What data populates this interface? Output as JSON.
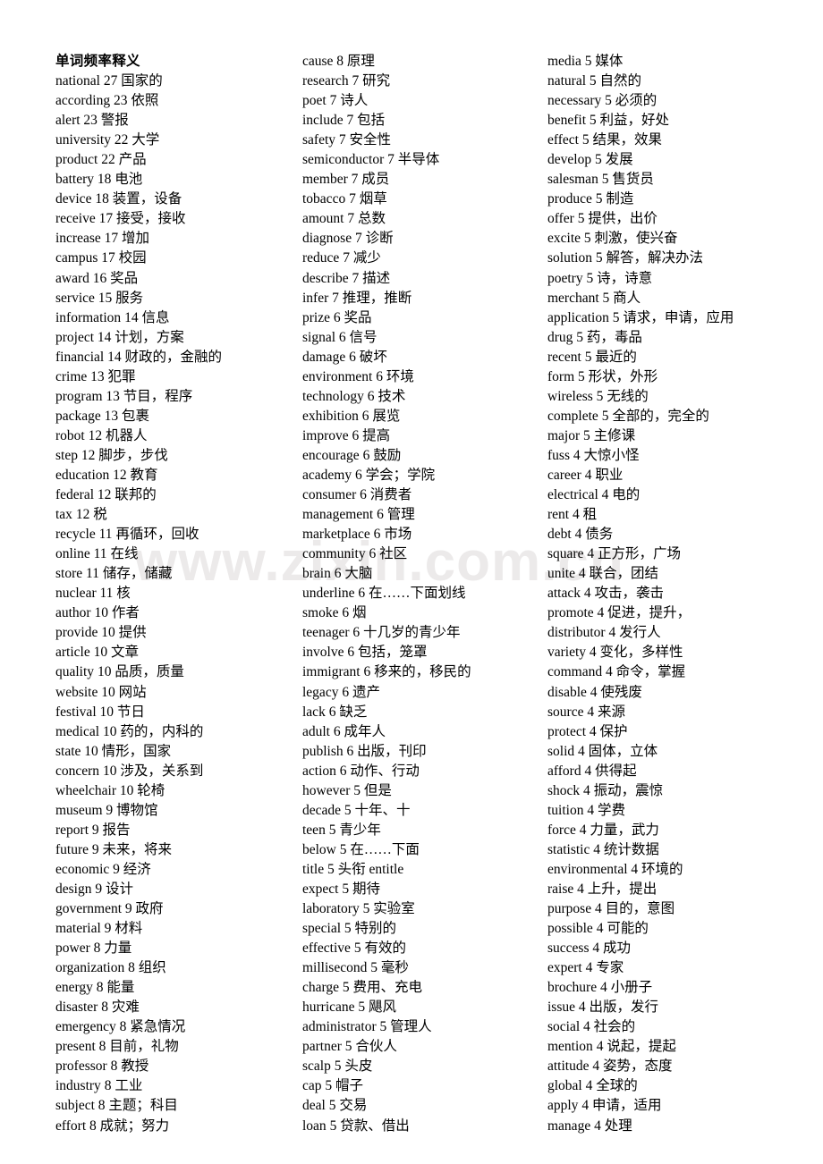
{
  "document": {
    "heading": "单词频率释义",
    "watermark": "www.zixin.com.cn"
  },
  "columns": [
    {
      "id": "col-1",
      "heading": "单词频率释义",
      "entries": [
        {
          "word": "national",
          "count": "27",
          "meaning": "国家的"
        },
        {
          "word": "according",
          "count": "23",
          "meaning": "依照"
        },
        {
          "word": "alert",
          "count": "23",
          "meaning": "警报"
        },
        {
          "word": "university",
          "count": "22",
          "meaning": "大学"
        },
        {
          "word": "product",
          "count": "22",
          "meaning": "产品"
        },
        {
          "word": "battery",
          "count": "18",
          "meaning": "电池"
        },
        {
          "word": "device",
          "count": "18",
          "meaning": "装置，设备"
        },
        {
          "word": "receive",
          "count": "17",
          "meaning": "接受，接收"
        },
        {
          "word": "increase",
          "count": "17",
          "meaning": "增加"
        },
        {
          "word": "campus",
          "count": "17",
          "meaning": "校园"
        },
        {
          "word": "award",
          "count": "16",
          "meaning": "奖品"
        },
        {
          "word": "service",
          "count": "15",
          "meaning": "服务"
        },
        {
          "word": "information",
          "count": "14",
          "meaning": "信息"
        },
        {
          "word": "project",
          "count": "14",
          "meaning": "计划，方案"
        },
        {
          "word": "financial",
          "count": "14",
          "meaning": "财政的，金融的"
        },
        {
          "word": "crime",
          "count": "13",
          "meaning": "犯罪"
        },
        {
          "word": "program",
          "count": "13",
          "meaning": "节目，程序"
        },
        {
          "word": "package",
          "count": "13",
          "meaning": "包裹"
        },
        {
          "word": "robot",
          "count": "12",
          "meaning": "机器人"
        },
        {
          "word": "step",
          "count": "12",
          "meaning": "脚步，步伐"
        },
        {
          "word": "education",
          "count": "12",
          "meaning": "教育"
        },
        {
          "word": "federal",
          "count": "12",
          "meaning": "联邦的"
        },
        {
          "word": "tax",
          "count": "12",
          "meaning": "税"
        },
        {
          "word": "recycle",
          "count": "11",
          "meaning": "再循环，回收"
        },
        {
          "word": "online",
          "count": "11",
          "meaning": "在线"
        },
        {
          "word": "store",
          "count": "11",
          "meaning": "储存，储藏"
        },
        {
          "word": "nuclear",
          "count": "11",
          "meaning": "核"
        },
        {
          "word": "author",
          "count": "10",
          "meaning": "作者"
        },
        {
          "word": "provide",
          "count": "10",
          "meaning": "提供"
        },
        {
          "word": "article",
          "count": "10",
          "meaning": "文章"
        },
        {
          "word": "quality",
          "count": "10",
          "meaning": "品质，质量"
        },
        {
          "word": "website",
          "count": "10",
          "meaning": "网站"
        },
        {
          "word": "festival",
          "count": "10",
          "meaning": "节日"
        },
        {
          "word": "medical",
          "count": "10",
          "meaning": "药的，内科的"
        },
        {
          "word": "state",
          "count": "10",
          "meaning": "情形，国家"
        },
        {
          "word": "concern",
          "count": "10",
          "meaning": "涉及，关系到"
        },
        {
          "word": "wheelchair",
          "count": "10",
          "meaning": "轮椅"
        },
        {
          "word": "museum",
          "count": "9",
          "meaning": "博物馆"
        },
        {
          "word": "report",
          "count": "9",
          "meaning": "报告"
        },
        {
          "word": "future",
          "count": "9",
          "meaning": "未来，将来"
        },
        {
          "word": "economic",
          "count": "9",
          "meaning": "经济"
        },
        {
          "word": "design",
          "count": "9",
          "meaning": "设计"
        },
        {
          "word": "government",
          "count": "9",
          "meaning": "政府"
        },
        {
          "word": "material",
          "count": "9",
          "meaning": "材料"
        },
        {
          "word": "power",
          "count": "8",
          "meaning": "力量"
        },
        {
          "word": "organization",
          "count": "8",
          "meaning": "组织"
        },
        {
          "word": "energy",
          "count": "8",
          "meaning": "能量"
        },
        {
          "word": "disaster",
          "count": "8",
          "meaning": "灾难"
        },
        {
          "word": "emergency",
          "count": "8",
          "meaning": "紧急情况"
        },
        {
          "word": "present",
          "count": "8",
          "meaning": "目前，礼物"
        },
        {
          "word": "professor",
          "count": "8",
          "meaning": "教授"
        },
        {
          "word": "industry",
          "count": "8",
          "meaning": "工业"
        },
        {
          "word": "subject",
          "count": "8",
          "meaning": "主题；科目"
        },
        {
          "word": "effort",
          "count": "8",
          "meaning": "成就；努力"
        }
      ]
    },
    {
      "id": "col-2",
      "heading": "",
      "entries": [
        {
          "word": "cause",
          "count": "8",
          "meaning": "原理"
        },
        {
          "word": "research",
          "count": "7",
          "meaning": "研究"
        },
        {
          "word": "poet",
          "count": "7",
          "meaning": "诗人"
        },
        {
          "word": "include",
          "count": "7",
          "meaning": "包括"
        },
        {
          "word": "safety",
          "count": "7",
          "meaning": "安全性"
        },
        {
          "word": "semiconductor",
          "count": "7",
          "meaning": "半导体"
        },
        {
          "word": "member",
          "count": "7",
          "meaning": "成员"
        },
        {
          "word": "tobacco",
          "count": "7",
          "meaning": "烟草"
        },
        {
          "word": "amount",
          "count": "7",
          "meaning": "总数"
        },
        {
          "word": "diagnose",
          "count": "7",
          "meaning": "诊断"
        },
        {
          "word": "reduce",
          "count": "7",
          "meaning": "减少"
        },
        {
          "word": "describe",
          "count": "7",
          "meaning": "描述"
        },
        {
          "word": "infer",
          "count": "7",
          "meaning": "推理，推断"
        },
        {
          "word": "prize",
          "count": "6",
          "meaning": "奖品"
        },
        {
          "word": "signal",
          "count": "6",
          "meaning": "信号"
        },
        {
          "word": "damage",
          "count": "6",
          "meaning": "破坏"
        },
        {
          "word": "environment",
          "count": "6",
          "meaning": "环境"
        },
        {
          "word": "technology",
          "count": "6",
          "meaning": "技术"
        },
        {
          "word": "exhibition",
          "count": "6",
          "meaning": "展览"
        },
        {
          "word": "improve",
          "count": "6",
          "meaning": "提高"
        },
        {
          "word": "encourage",
          "count": "6",
          "meaning": "鼓励"
        },
        {
          "word": "academy",
          "count": "6",
          "meaning": "学会；学院"
        },
        {
          "word": "consumer",
          "count": "6",
          "meaning": "消费者"
        },
        {
          "word": "management",
          "count": "6",
          "meaning": "管理"
        },
        {
          "word": "marketplace",
          "count": "6",
          "meaning": "市场"
        },
        {
          "word": "community",
          "count": "6",
          "meaning": "社区"
        },
        {
          "word": "brain",
          "count": "6",
          "meaning": "大脑"
        },
        {
          "word": "underline",
          "count": "6",
          "meaning": "在……下面划线"
        },
        {
          "word": "smoke",
          "count": "6",
          "meaning": "烟"
        },
        {
          "word": "teenager",
          "count": "6",
          "meaning": "十几岁的青少年"
        },
        {
          "word": "involve",
          "count": "6",
          "meaning": "包括，笼罩"
        },
        {
          "word": "immigrant",
          "count": "6",
          "meaning": "移来的，移民的"
        },
        {
          "word": "legacy",
          "count": "6",
          "meaning": "遗产"
        },
        {
          "word": "lack",
          "count": "6",
          "meaning": "缺乏"
        },
        {
          "word": "adult",
          "count": "6",
          "meaning": "成年人"
        },
        {
          "word": "publish",
          "count": "6",
          "meaning": "出版，刊印"
        },
        {
          "word": "action",
          "count": "6",
          "meaning": "动作、行动"
        },
        {
          "word": "however",
          "count": "5",
          "meaning": "但是"
        },
        {
          "word": "decade",
          "count": "5",
          "meaning": "十年、十"
        },
        {
          "word": "teen",
          "count": "5",
          "meaning": "青少年"
        },
        {
          "word": "below",
          "count": "5",
          "meaning": "在……下面"
        },
        {
          "word": "title",
          "count": "5",
          "meaning": "头衔 entitle"
        },
        {
          "word": "expect",
          "count": "5",
          "meaning": "期待"
        },
        {
          "word": "laboratory",
          "count": "5",
          "meaning": "实验室"
        },
        {
          "word": "special",
          "count": "5",
          "meaning": "特别的"
        },
        {
          "word": "effective",
          "count": "5",
          "meaning": "有效的"
        },
        {
          "word": "millisecond",
          "count": "5",
          "meaning": "毫秒"
        },
        {
          "word": "charge",
          "count": "5",
          "meaning": "费用、充电"
        },
        {
          "word": "hurricane",
          "count": "5",
          "meaning": "飓风"
        },
        {
          "word": "administrator",
          "count": "5",
          "meaning": "管理人"
        },
        {
          "word": "partner",
          "count": "5",
          "meaning": "合伙人"
        },
        {
          "word": "scalp",
          "count": "5",
          "meaning": "头皮"
        },
        {
          "word": "cap",
          "count": "5",
          "meaning": "帽子"
        },
        {
          "word": "deal",
          "count": "5",
          "meaning": "交易"
        },
        {
          "word": "loan",
          "count": "5",
          "meaning": "贷款、借出"
        }
      ]
    },
    {
      "id": "col-3",
      "heading": "",
      "entries": [
        {
          "word": "media",
          "count": "5",
          "meaning": "媒体"
        },
        {
          "word": "natural",
          "count": "5",
          "meaning": "自然的"
        },
        {
          "word": "necessary",
          "count": "5",
          "meaning": "必须的"
        },
        {
          "word": "benefit",
          "count": "5",
          "meaning": "利益，好处"
        },
        {
          "word": "effect",
          "count": "5",
          "meaning": "结果，效果"
        },
        {
          "word": "develop",
          "count": "5",
          "meaning": "发展"
        },
        {
          "word": "salesman",
          "count": "5",
          "meaning": "售货员"
        },
        {
          "word": "produce",
          "count": "5",
          "meaning": "制造"
        },
        {
          "word": "offer",
          "count": "5",
          "meaning": "提供，出价"
        },
        {
          "word": "excite",
          "count": "5",
          "meaning": "刺激，使兴奋"
        },
        {
          "word": "solution",
          "count": "5",
          "meaning": "解答，解决办法"
        },
        {
          "word": "poetry",
          "count": "5",
          "meaning": "诗，诗意"
        },
        {
          "word": "merchant",
          "count": "5",
          "meaning": "商人"
        },
        {
          "word": "application",
          "count": "5",
          "meaning": "请求，申请，应用"
        },
        {
          "word": "drug",
          "count": "5",
          "meaning": "药，毒品"
        },
        {
          "word": "recent",
          "count": "5",
          "meaning": "最近的"
        },
        {
          "word": "form",
          "count": "5",
          "meaning": "形状，外形"
        },
        {
          "word": "wireless",
          "count": "5",
          "meaning": "无线的"
        },
        {
          "word": "complete",
          "count": "5",
          "meaning": "全部的，完全的"
        },
        {
          "word": "major",
          "count": "5",
          "meaning": "主修课"
        },
        {
          "word": "fuss",
          "count": "4",
          "meaning": "大惊小怪"
        },
        {
          "word": "career",
          "count": "4",
          "meaning": "职业"
        },
        {
          "word": "electrical",
          "count": "4",
          "meaning": "电的"
        },
        {
          "word": "rent",
          "count": "4",
          "meaning": "租"
        },
        {
          "word": "debt",
          "count": "4",
          "meaning": "债务"
        },
        {
          "word": "square",
          "count": "4",
          "meaning": "正方形，广场"
        },
        {
          "word": "unite",
          "count": "4",
          "meaning": "联合，团结"
        },
        {
          "word": "attack",
          "count": "4",
          "meaning": "攻击，袭击"
        },
        {
          "word": "promote",
          "count": "4",
          "meaning": "促进，提升，"
        },
        {
          "word": "distributor",
          "count": "4",
          "meaning": "发行人"
        },
        {
          "word": "variety",
          "count": "4",
          "meaning": "变化，多样性"
        },
        {
          "word": "command",
          "count": "4",
          "meaning": "命令，掌握"
        },
        {
          "word": "disable",
          "count": "4",
          "meaning": "使残废"
        },
        {
          "word": "source",
          "count": "4",
          "meaning": "来源"
        },
        {
          "word": "protect",
          "count": "4",
          "meaning": "保护"
        },
        {
          "word": "solid",
          "count": "4",
          "meaning": "固体，立体"
        },
        {
          "word": "afford",
          "count": "4",
          "meaning": "供得起"
        },
        {
          "word": "shock",
          "count": "4",
          "meaning": "振动，震惊"
        },
        {
          "word": "tuition",
          "count": "4",
          "meaning": "学费"
        },
        {
          "word": "force",
          "count": "4",
          "meaning": "力量，武力"
        },
        {
          "word": "statistic",
          "count": "4",
          "meaning": "统计数据"
        },
        {
          "word": "environmental",
          "count": "4",
          "meaning": "环境的"
        },
        {
          "word": "raise",
          "count": "4",
          "meaning": "上升，提出"
        },
        {
          "word": "purpose",
          "count": "4",
          "meaning": "目的，意图"
        },
        {
          "word": "possible",
          "count": "4",
          "meaning": "可能的"
        },
        {
          "word": "success",
          "count": "4",
          "meaning": "成功"
        },
        {
          "word": "expert",
          "count": "4",
          "meaning": "专家"
        },
        {
          "word": "brochure",
          "count": "4",
          "meaning": "小册子"
        },
        {
          "word": "issue",
          "count": "4",
          "meaning": "出版，发行"
        },
        {
          "word": "social",
          "count": "4",
          "meaning": "社会的"
        },
        {
          "word": "mention",
          "count": "4",
          "meaning": "说起，提起"
        },
        {
          "word": "attitude",
          "count": "4",
          "meaning": "姿势，态度"
        },
        {
          "word": "global",
          "count": "4",
          "meaning": "全球的"
        },
        {
          "word": "apply",
          "count": "4",
          "meaning": "申请，适用"
        },
        {
          "word": "manage",
          "count": "4",
          "meaning": "处理"
        }
      ]
    }
  ]
}
